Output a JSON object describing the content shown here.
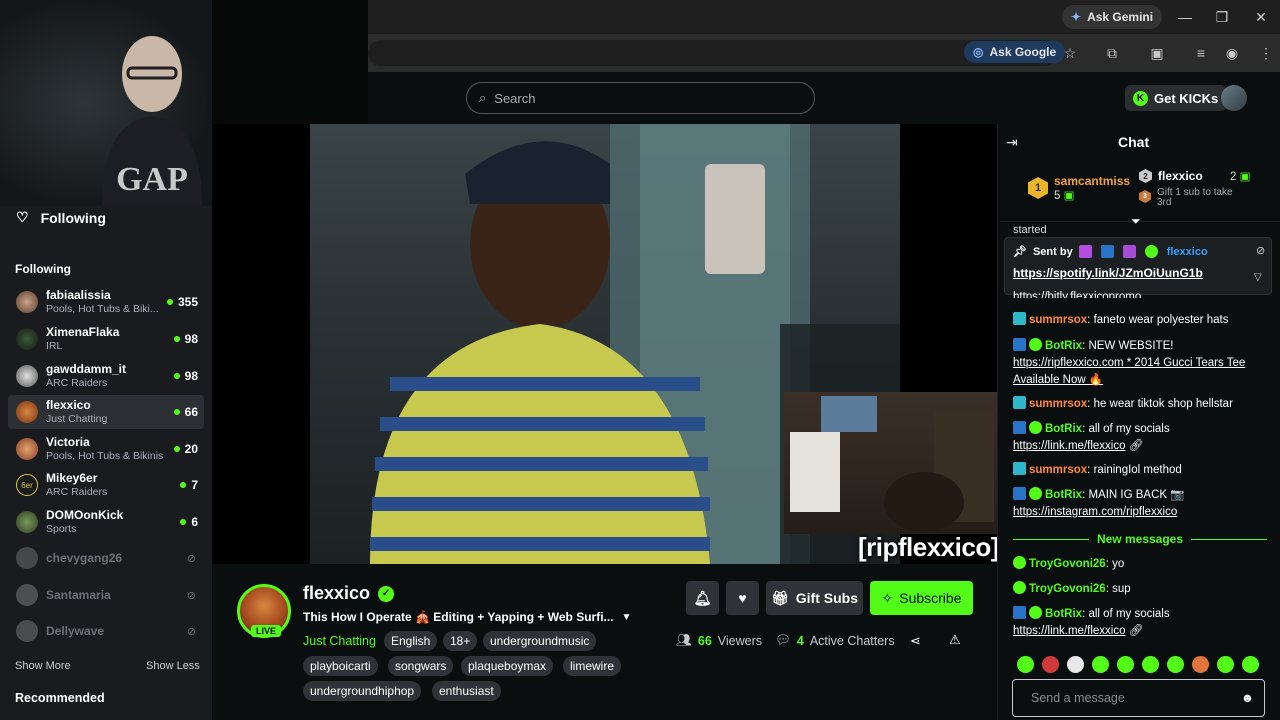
{
  "browser": {
    "ask_gemini": "Ask Gemini",
    "ask_google": "Ask Google"
  },
  "topnav": {
    "search_placeholder": "Search",
    "get_kicks": "Get KICKs"
  },
  "sidebar": {
    "following_header": "Following",
    "section_label": "Following",
    "items": [
      {
        "name": "fabiaalissia",
        "category": "Pools, Hot Tubs & Biki...",
        "viewers": "355",
        "online": true
      },
      {
        "name": "XimenaFlaka",
        "category": "IRL",
        "viewers": "98",
        "online": true
      },
      {
        "name": "gawddamm_it",
        "category": "ARC Raiders",
        "viewers": "98",
        "online": true
      },
      {
        "name": "flexxico",
        "category": "Just Chatting",
        "viewers": "66",
        "online": true
      },
      {
        "name": "Victoria",
        "category": "Pools, Hot Tubs & Bikinis",
        "viewers": "20",
        "online": true
      },
      {
        "name": "Mikey6er",
        "category": "ARC Raiders",
        "viewers": "7",
        "online": true
      },
      {
        "name": "DOMOonKick",
        "category": "Sports",
        "viewers": "6",
        "online": true
      },
      {
        "name": "chevygang26",
        "online": false
      },
      {
        "name": "Santamaria",
        "online": false
      },
      {
        "name": "Dellywave",
        "online": false
      }
    ],
    "show_more": "Show More",
    "show_less": "Show Less",
    "recommended": "Recommended"
  },
  "player": {
    "watermark": "[ripflexxico]"
  },
  "stream": {
    "channel_name": "flexxico",
    "live_badge": "LIVE",
    "title": "This How I Operate 🎪 Editing + Yapping + Web Surfi...",
    "category": "Just Chatting",
    "tags": [
      "English",
      "18+",
      "undergroundmusic",
      "playboicarti",
      "songwars",
      "plaqueboymax",
      "limewire",
      "undergroundhiphop",
      "enthusiast"
    ],
    "gift_subs": "Gift Subs",
    "subscribe": "Subscribe",
    "viewers_count": "66",
    "viewers_label": "Viewers",
    "chatters_count": "4",
    "chatters_label": "Active Chatters"
  },
  "chat": {
    "title": "Chat",
    "leaderboard": {
      "first_name": "samcantmiss",
      "first_rank": "1",
      "first_count": "5",
      "second_name": "flexxico",
      "second_rank": "2",
      "second_count": "2",
      "third_rank": "3",
      "third_text": "Gift 1 sub to take 3rd"
    },
    "scroll_text": "started",
    "pinned": {
      "sent_by": "Sent by",
      "user": "flexxico",
      "link": "https://spotify.link/JZmOiUunG1b"
    },
    "cutoff_link": "https://bitly.flexxicopromo",
    "messages": [
      {
        "user": "summrsox",
        "color": "#e05cff",
        "text": "faneto wear polyester hats"
      },
      {
        "user": "BotRix",
        "color": "#53fc18",
        "link": "NEW WEBSITE!",
        "text": "https://ripflexxico.com * 2014 Gucci Tears Tee Available Now 🔥"
      },
      {
        "user": "summrsox",
        "color": "#e05cff",
        "text": "he wear tiktok shop hellstar"
      },
      {
        "user": "BotRix",
        "color": "#53fc18",
        "text": "all of my socials",
        "link": "https://link.me/flexxico"
      },
      {
        "user": "summrsox",
        "color": "#e05cff",
        "text": "rainingIol method"
      },
      {
        "user": "BotRix",
        "color": "#53fc18",
        "text": "MAIN IG BACK 📷",
        "link": "https://instagram.com/ripflexxico"
      }
    ],
    "new_messages": "New messages",
    "new": [
      {
        "user": "TroyGovoni26",
        "color": "#53fc18",
        "text": "yo"
      },
      {
        "user": "TroyGovoni26",
        "color": "#53fc18",
        "text": "sup"
      },
      {
        "user": "BotRix",
        "color": "#53fc18",
        "text": "all of my socials",
        "link": "https://link.me/flexxico"
      }
    ],
    "input_placeholder": "Send a message"
  }
}
